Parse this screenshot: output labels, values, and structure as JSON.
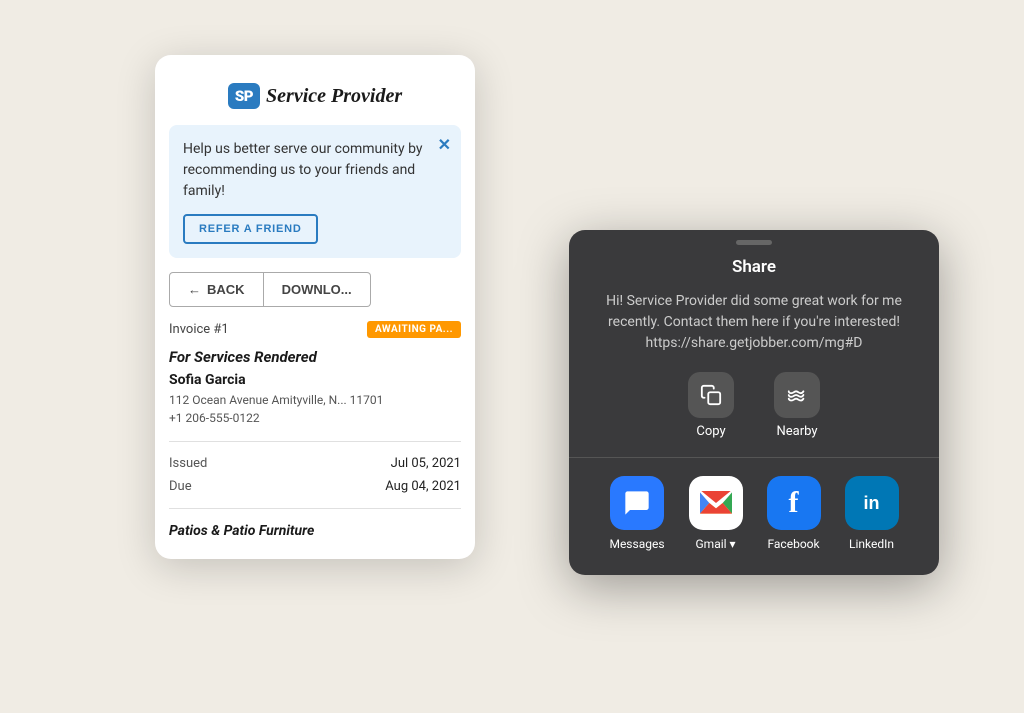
{
  "app": {
    "background": "#f0ece4"
  },
  "phone": {
    "logo_sp": "SP",
    "logo_name": "Service Provider",
    "banner": {
      "text": "Help us better serve our community by recommending us to your friends and family!",
      "button_label": "REFER A FRIEND",
      "close_icon": "✕"
    },
    "back_button": "← BACK",
    "download_button": "DOWNLO...",
    "invoice": {
      "number": "Invoice #1",
      "status": "AWAITING PA...",
      "title": "For Services Rendered",
      "client_name": "Sofia Garcia",
      "client_address": "112 Ocean Avenue Amityville, N... 11701",
      "client_phone": "+1 206-555-0122",
      "issued_label": "Issued",
      "issued_date": "Jul 05, 2021",
      "due_label": "Due",
      "due_date": "Aug 04, 2021",
      "line_item_title": "Patios & Patio Furniture"
    }
  },
  "share_sheet": {
    "handle": "",
    "title": "Share",
    "message": "Hi! Service Provider did some great work for me recently. Contact them here if you're interested! https://share.getjobber.com/mg#D",
    "copy_label": "Copy",
    "nearby_label": "Nearby",
    "apps": [
      {
        "id": "messages",
        "label": "Messages",
        "icon": "💬",
        "style": "messages"
      },
      {
        "id": "gmail",
        "label": "Gmail ▾",
        "icon": "M",
        "style": "gmail"
      },
      {
        "id": "facebook",
        "label": "Facebook",
        "icon": "f",
        "style": "facebook"
      },
      {
        "id": "linkedin",
        "label": "LinkedIn",
        "icon": "in",
        "style": "linkedin"
      }
    ]
  }
}
